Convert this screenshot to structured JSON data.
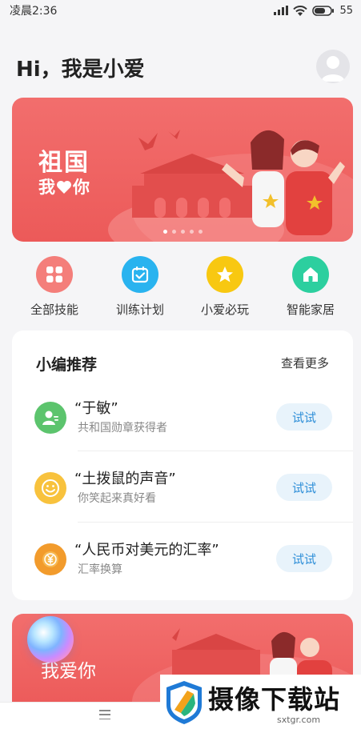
{
  "status_bar": {
    "time": "凌晨2:36",
    "battery": "55"
  },
  "header": {
    "greeting": "Hi，我是小爱"
  },
  "banner": {
    "line1": "祖国",
    "line2_prefix": "我",
    "line2_suffix": "你",
    "active_dot": 0,
    "dot_count": 5
  },
  "quick_actions": [
    {
      "label": "全部技能",
      "icon": "grid-icon",
      "color": "#f47e7a"
    },
    {
      "label": "训练计划",
      "icon": "calendar-check-icon",
      "color": "#29b3ef"
    },
    {
      "label": "小爱必玩",
      "icon": "star-icon",
      "color": "#f8c811"
    },
    {
      "label": "智能家居",
      "icon": "home-icon",
      "color": "#2ccf9f"
    }
  ],
  "recommend": {
    "title": "小编推荐",
    "more": "查看更多",
    "items": [
      {
        "title": "“于敏”",
        "subtitle": "共和国勋章获得者",
        "button": "试试",
        "icon": "person-icon",
        "color": "#5cc46d"
      },
      {
        "title": "“土拨鼠的声音”",
        "subtitle": "你笑起来真好看",
        "button": "试试",
        "icon": "smile-icon",
        "color": "#f8c23d"
      },
      {
        "title": "“人民币对美元的汇率”",
        "subtitle": "汇率换算",
        "button": "试试",
        "icon": "coin-icon",
        "color": "#f29b2c"
      }
    ]
  },
  "banner2": {
    "text": "我爱你"
  },
  "watermark": {
    "text": "摄像下载站",
    "url": "sxtgr.com"
  }
}
